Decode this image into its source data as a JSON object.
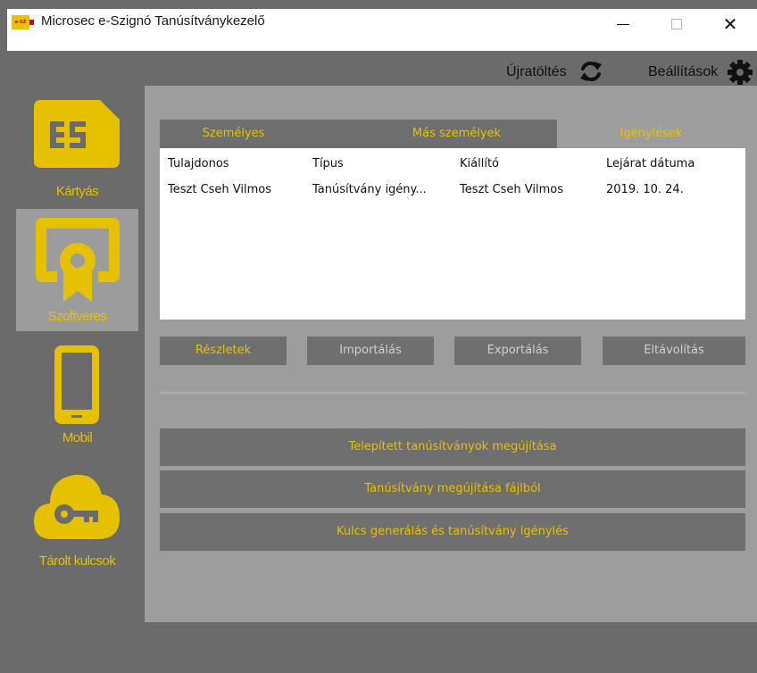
{
  "window": {
    "title": "Microsec e-Szignó Tanúsítványkezelő",
    "app_icon_text": "e-SZ",
    "minimize_icon": "minimize-icon",
    "maximize_icon": "maximize-icon",
    "close_icon": "close-icon",
    "close_glyph": "✕"
  },
  "toolbar": {
    "reload_label": "Újratöltés",
    "reload_icon": "refresh-icon",
    "settings_label": "Beállítások",
    "settings_icon": "gear-icon"
  },
  "sidebar": {
    "items": [
      {
        "label": "Kártyás",
        "icon": "sim-card-icon",
        "selected": false
      },
      {
        "label": "Szoftveres",
        "icon": "certificate-icon",
        "selected": true
      },
      {
        "label": "Mobil",
        "icon": "smartphone-icon",
        "selected": false
      },
      {
        "label": "Tárolt kulcsok",
        "icon": "cloud-key-icon",
        "selected": false
      }
    ]
  },
  "tabs": [
    {
      "label": "Személyes",
      "active": false
    },
    {
      "label": "Más személyek",
      "active": false
    },
    {
      "label": "Igénylések",
      "active": true
    }
  ],
  "table": {
    "columns": [
      "Tulajdonos",
      "Típus",
      "Kiállító",
      "Lejárat dátuma"
    ],
    "rows": [
      [
        "Teszt Cseh Vilmos",
        "Tanúsítvány igény...",
        "Teszt Cseh Vilmos",
        "2019. 10. 24."
      ]
    ]
  },
  "actions": {
    "details_label": "Részletek",
    "import_label": "Importálás",
    "export_label": "Exportálás",
    "remove_label": "Eltávolítás"
  },
  "renewal_actions": {
    "renew_installed_label": "Telepített tanúsítványok megújítása",
    "renew_from_file_label": "Tanúsítvány megújítása fájlból",
    "generate_key_label": "Kulcs generálás és tanúsítvány igénylés"
  },
  "colors": {
    "accent": "#e5c100",
    "background": "#6b6b6b",
    "panel": "#9d9d9d",
    "button": "#6f6f6f",
    "disabled_text": "#cfcfcf"
  }
}
